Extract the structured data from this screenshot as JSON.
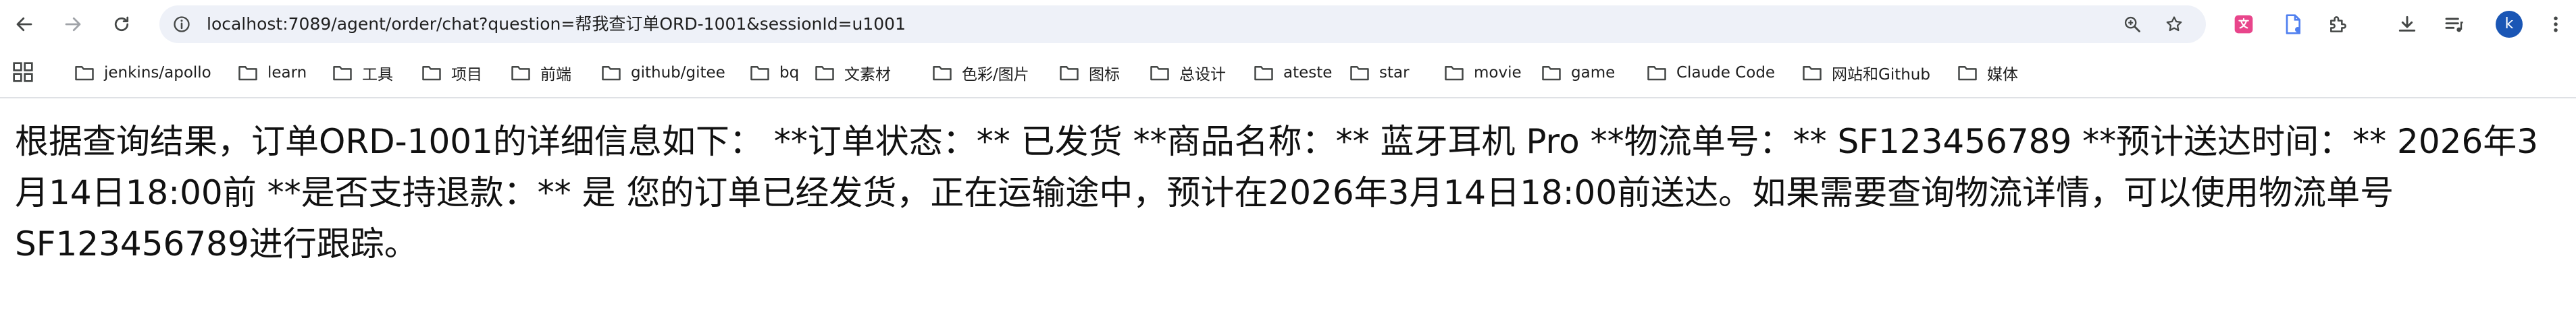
{
  "browser": {
    "url": "localhost:7089/agent/order/chat?question=帮我查订单ORD-1001&sessionId=u1001",
    "profile_initial": "k",
    "accent_color": "#1a56b5"
  },
  "icons": {
    "back": "arrow-left-icon",
    "forward": "arrow-right-icon",
    "reload": "reload-icon",
    "site_info": "site-info-icon",
    "zoom": "zoom-icon",
    "bookmark_star": "star-icon",
    "extensions": [
      "translate-extension-icon",
      "google-docs-extension-icon",
      "puzzle-icon",
      "download-icon",
      "media-queue-icon"
    ],
    "menu": "kebab-menu-icon",
    "apps": "apps-grid-icon",
    "folder": "folder-icon"
  },
  "bookmarks": [
    "jenkins/apollo",
    "learn",
    "工具",
    "项目",
    "前端",
    "github/gitee",
    "bq",
    "文素材",
    "色彩/图片",
    "图标",
    "总设计",
    "ateste",
    "star",
    "movie",
    "game",
    "Claude Code",
    "网站和Github",
    "媒体"
  ],
  "page": {
    "response_text": "根据查询结果，订单ORD-1001的详细信息如下： **订单状态：** 已发货 **商品名称：** 蓝牙耳机 Pro **物流单号：** SF123456789 **预计送达时间：** 2026年3月14日18:00前 **是否支持退款：** 是 您的订单已经发货，正在运输途中，预计在2026年3月14日18:00前送达。如果需要查询物流详情，可以使用物流单号SF123456789进行跟踪。"
  }
}
